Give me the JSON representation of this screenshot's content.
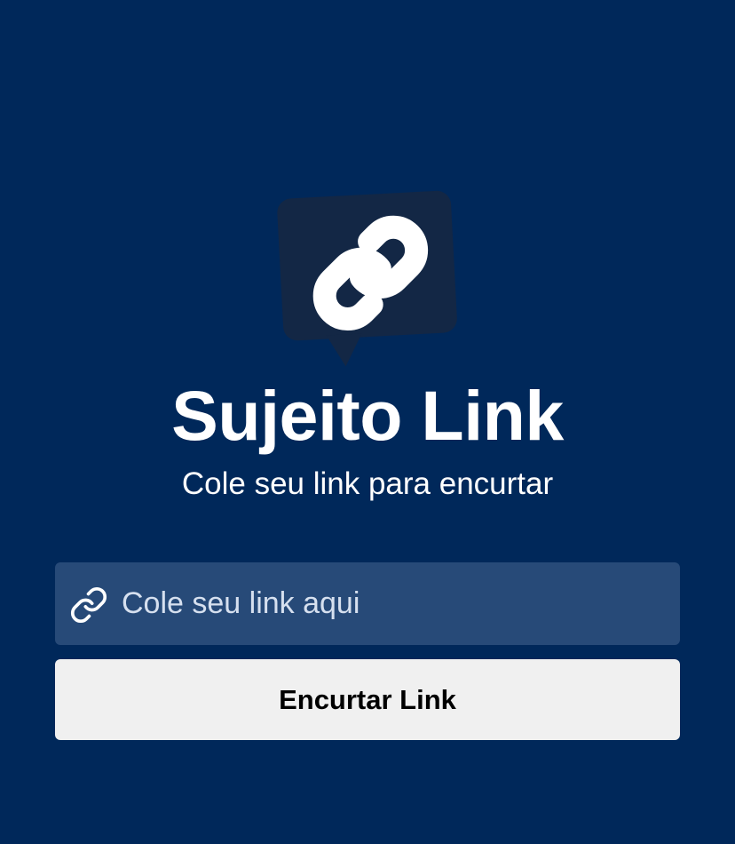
{
  "app": {
    "title": "Sujeito Link",
    "subtitle": "Cole seu link para encurtar"
  },
  "icons": {
    "logo": "speech-bubble-link-icon",
    "input": "link-icon"
  },
  "form": {
    "input_value": "",
    "input_placeholder": "Cole seu link aqui",
    "button_label": "Encurtar Link"
  },
  "colors": {
    "background": "#00285a",
    "logo_bubble": "#132745",
    "input_background": "#274a78",
    "button_background": "#f0f0f0",
    "text_primary": "#ffffff"
  }
}
